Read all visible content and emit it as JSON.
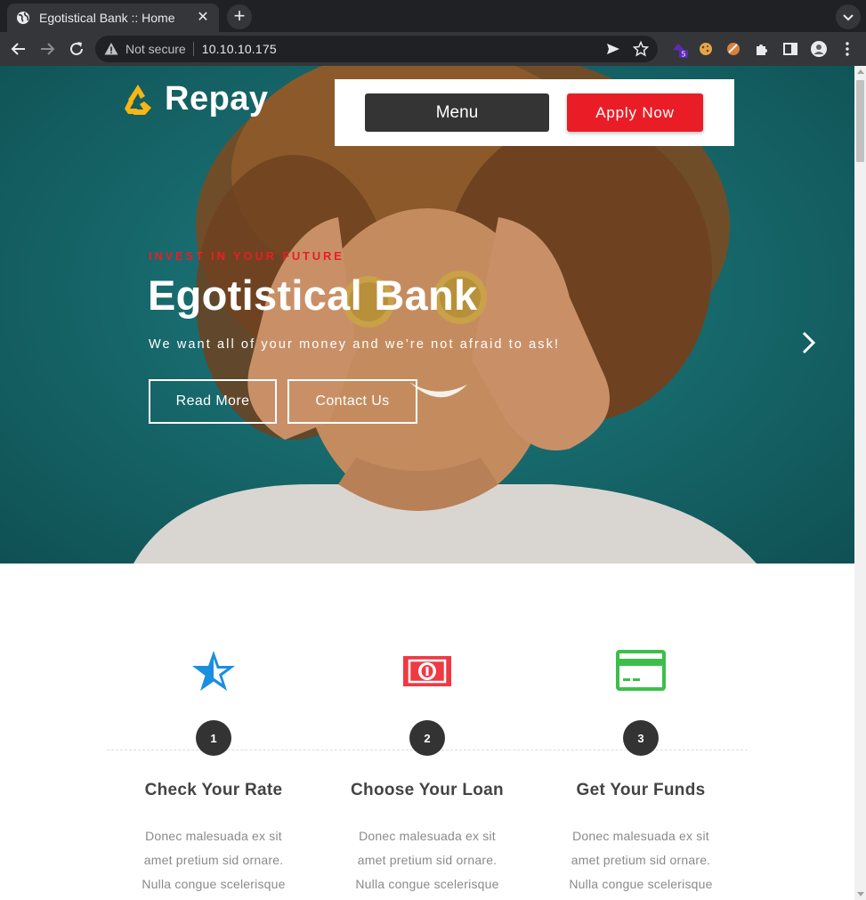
{
  "browser": {
    "tab_title": "Egotistical Bank :: Home",
    "security_label": "Not secure",
    "url": "10.10.10.175",
    "extension_badge": "5"
  },
  "header": {
    "logo_text": "Repay",
    "menu_label": "Menu",
    "apply_label": "Apply Now"
  },
  "hero": {
    "kicker": "INVEST IN YOUR FUTURE",
    "title": "Egotistical Bank",
    "subtitle": "We want all of your money and we’re not afraid to ask!",
    "read_more": "Read More",
    "contact_us": "Contact Us"
  },
  "steps": [
    {
      "number": "1",
      "icon": "star-icon",
      "title": "Check Your Rate",
      "text": "Donec malesuada ex sit amet pretium sid ornare. Nulla congue scelerisque"
    },
    {
      "number": "2",
      "icon": "banknote-icon",
      "title": "Choose Your Loan",
      "text": "Donec malesuada ex sit amet pretium sid ornare. Nulla congue scelerisque"
    },
    {
      "number": "3",
      "icon": "credit-card-icon",
      "title": "Get Your Funds",
      "text": "Donec malesuada ex sit amet pretium sid ornare. Nulla congue scelerisque"
    }
  ],
  "colors": {
    "accent_red": "#ea1d26",
    "hero_teal": "#17696c",
    "star_blue": "#1a8fe0",
    "note_red": "#ee3a43",
    "card_green": "#3cbf4a"
  }
}
